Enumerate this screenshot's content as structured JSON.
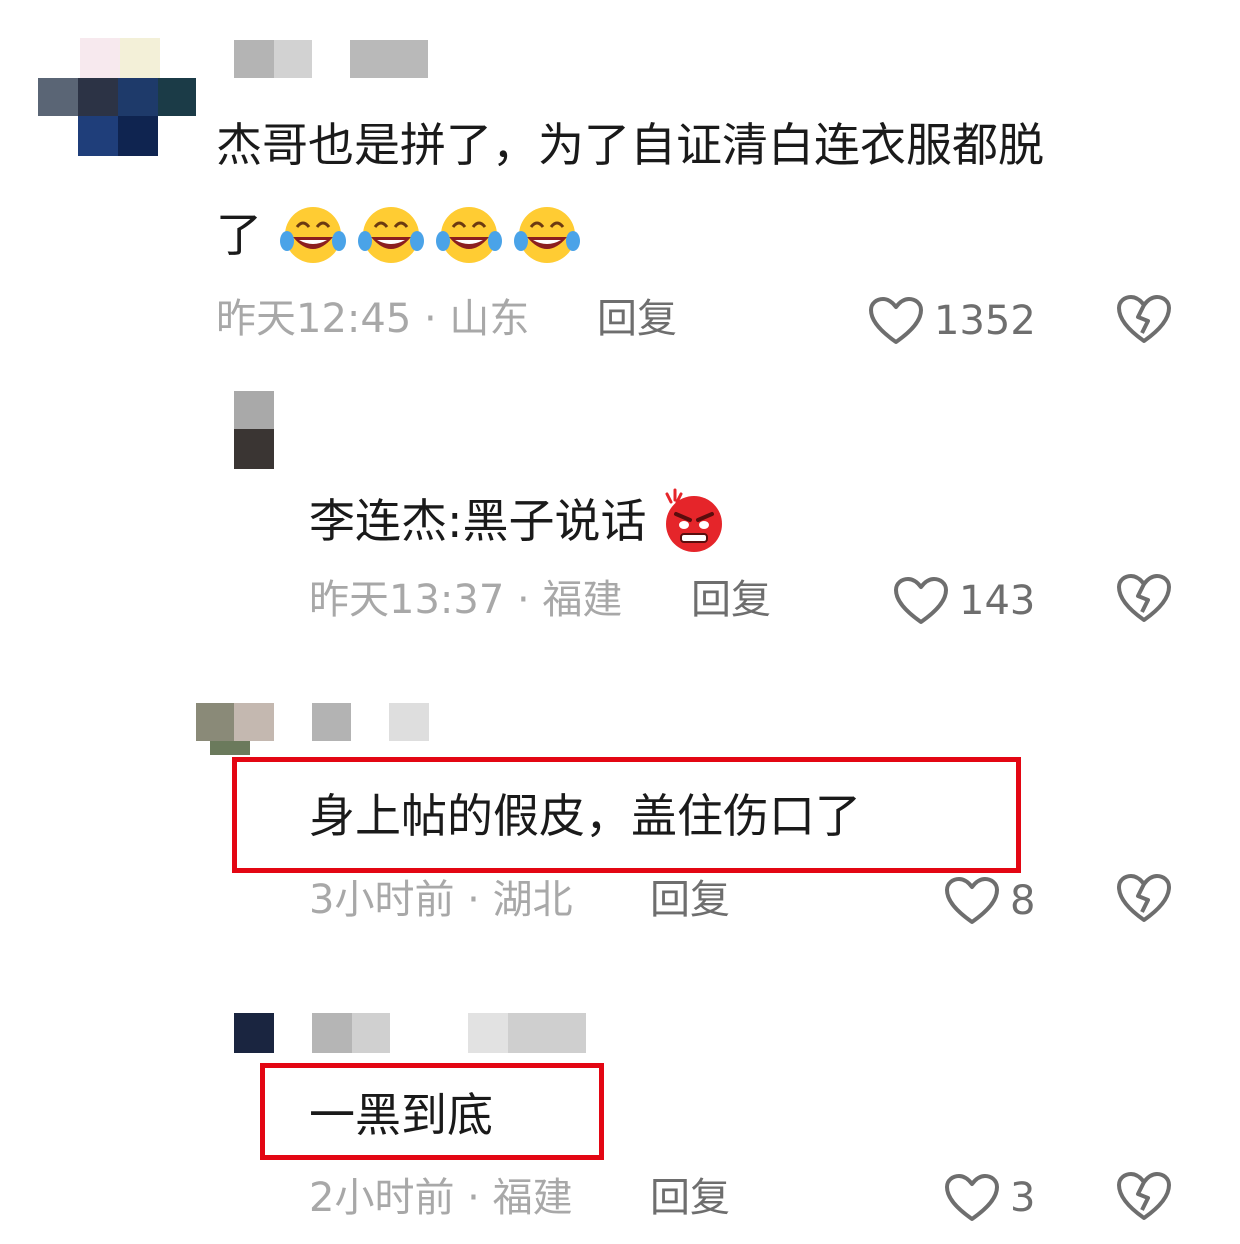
{
  "comments": [
    {
      "text_line1": "杰哥也是拼了，为了自证清白连衣服都脱",
      "text_line2": "了",
      "emoji": "😂",
      "meta": "昨天12:45 · 山东",
      "reply_label": "回复",
      "likes": "1352",
      "heart_icon": "heart-outline-icon",
      "dislike_icon": "broken-heart-icon"
    },
    {
      "text": "李连杰:黑子说话",
      "emoji": "😡",
      "meta": "昨天13:37 · 福建",
      "reply_label": "回复",
      "likes": "143",
      "heart_icon": "heart-outline-icon",
      "dislike_icon": "broken-heart-icon"
    },
    {
      "text": "身上帖的假皮，盖住伤口了",
      "meta": "3小时前 · 湖北",
      "reply_label": "回复",
      "likes": "8",
      "highlight_color": "#e30613",
      "heart_icon": "heart-outline-icon",
      "dislike_icon": "broken-heart-icon"
    },
    {
      "text": "一黑到底",
      "meta": "2小时前 · 福建",
      "reply_label": "回复",
      "likes": "3",
      "highlight_color": "#e30613",
      "heart_icon": "heart-outline-icon",
      "dislike_icon": "broken-heart-icon"
    }
  ]
}
